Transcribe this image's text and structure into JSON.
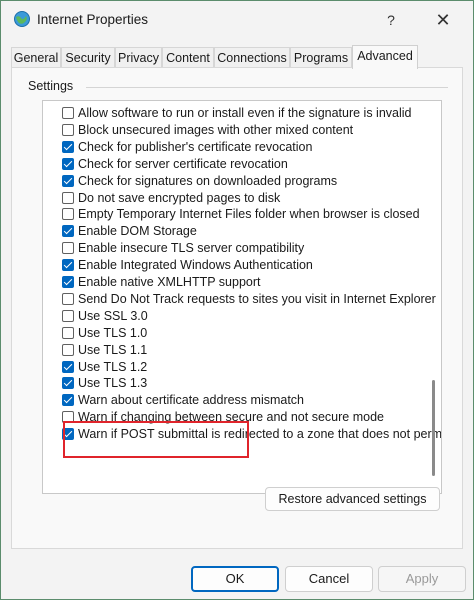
{
  "window": {
    "title": "Internet Properties",
    "help_glyph": "?",
    "close_glyph": "✕"
  },
  "tabs": [
    {
      "label": "General",
      "active": false
    },
    {
      "label": "Security",
      "active": false
    },
    {
      "label": "Privacy",
      "active": false
    },
    {
      "label": "Content",
      "active": false
    },
    {
      "label": "Connections",
      "active": false
    },
    {
      "label": "Programs",
      "active": false
    },
    {
      "label": "Advanced",
      "active": true
    }
  ],
  "settings": {
    "group_label": "Settings",
    "items": [
      {
        "label": "Allow software to run or install even if the signature is invalid",
        "checked": false
      },
      {
        "label": "Block unsecured images with other mixed content",
        "checked": false
      },
      {
        "label": "Check for publisher's certificate revocation",
        "checked": true
      },
      {
        "label": "Check for server certificate revocation",
        "checked": true
      },
      {
        "label": "Check for signatures on downloaded programs",
        "checked": true
      },
      {
        "label": "Do not save encrypted pages to disk",
        "checked": false
      },
      {
        "label": "Empty Temporary Internet Files folder when browser is closed",
        "checked": false
      },
      {
        "label": "Enable DOM Storage",
        "checked": true
      },
      {
        "label": "Enable insecure TLS server compatibility",
        "checked": false
      },
      {
        "label": "Enable Integrated Windows Authentication",
        "checked": true
      },
      {
        "label": "Enable native XMLHTTP support",
        "checked": true
      },
      {
        "label": "Send Do Not Track requests to sites you visit in Internet Explorer",
        "checked": false
      },
      {
        "label": "Use SSL 3.0",
        "checked": false
      },
      {
        "label": "Use TLS 1.0",
        "checked": false
      },
      {
        "label": "Use TLS 1.1",
        "checked": false
      },
      {
        "label": "Use TLS 1.2",
        "checked": true
      },
      {
        "label": "Use TLS 1.3",
        "checked": true
      },
      {
        "label": "Warn about certificate address mismatch",
        "checked": true
      },
      {
        "label": "Warn if changing between secure and not secure mode",
        "checked": false
      },
      {
        "label": "Warn if POST submittal is redirected to a zone that does not permit posts",
        "checked": true
      }
    ],
    "restore_label": "Restore advanced settings"
  },
  "footer": {
    "ok_label": "OK",
    "cancel_label": "Cancel",
    "apply_label": "Apply"
  },
  "colors": {
    "accent": "#0067c0",
    "highlight_box": "#e0242b"
  }
}
